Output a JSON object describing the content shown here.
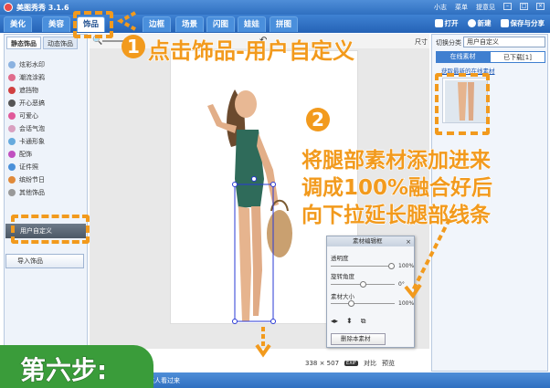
{
  "app": {
    "title": "美图秀秀 3.1.6"
  },
  "titlebar": {
    "user": "小志",
    "menu": "菜单",
    "feedback": "提意见",
    "min": "–",
    "max": "□",
    "close": "×"
  },
  "menu": {
    "tabs": [
      "美化",
      "美容",
      "饰品",
      "边框",
      "场景",
      "闪图",
      "娃娃",
      "拼图"
    ],
    "active": "饰品",
    "open": "打开",
    "new": "新建",
    "save_share": "保存与分享"
  },
  "left_panel": {
    "tabs": [
      "静态饰品",
      "动态饰品"
    ],
    "items": [
      {
        "label": "炫彩水印",
        "color": "#8bb2e0"
      },
      {
        "label": "潮流涂鸦",
        "color": "#e06b8b"
      },
      {
        "label": "遮挡物",
        "color": "#d04040"
      },
      {
        "label": "开心恶搞",
        "color": "#555555"
      },
      {
        "label": "可爱心",
        "color": "#e05a9a"
      },
      {
        "label": "会话气泡",
        "color": "#d9a0c0"
      },
      {
        "label": "卡通形象",
        "color": "#66aadd"
      },
      {
        "label": "配饰",
        "color": "#c050c0"
      },
      {
        "label": "证件照",
        "color": "#4a90d9"
      },
      {
        "label": "缤纷节日",
        "color": "#e08a3a"
      },
      {
        "label": "其他饰品",
        "color": "#999999"
      }
    ],
    "selected": "用户自定义",
    "import": "导入饰品"
  },
  "canvas": {
    "size_label": "尺寸"
  },
  "right_panel": {
    "category_label": "切换分类",
    "category_value": "用户自定义",
    "tabs": [
      "在线素材",
      "已下载[1]"
    ],
    "active_tab": "已下载[1]",
    "link": "获取最新的在线素材"
  },
  "edit_box": {
    "title": "素材编辑框",
    "close": "×",
    "opacity_label": "透明度",
    "opacity_value": "100%",
    "opacity_level": 100,
    "rotate_label": "旋转角度",
    "rotate_value": "0°",
    "rotate_level": 50,
    "size_label": "素材大小",
    "size_value": "100%",
    "size_level": 30,
    "delete": "删除本素材"
  },
  "status": {
    "dimensions": "338 × 507",
    "badge": "EXIF",
    "compare": "对比",
    "preview": "预览"
  },
  "bottom": {
    "text": "美图达人看过来"
  },
  "annotations": {
    "step1_num": "1",
    "step1_text": "点击饰品-用户自定义",
    "step2_num": "2",
    "step2_lines": [
      "将腿部素材添加进来",
      "调成100%融合好后",
      "向下拉延长腿部线条"
    ],
    "step_banner": "第六步:"
  },
  "colors": {
    "accent": "#f29a1d",
    "banner": "#3a9c3a",
    "titlebar": "#2f6fc0"
  }
}
